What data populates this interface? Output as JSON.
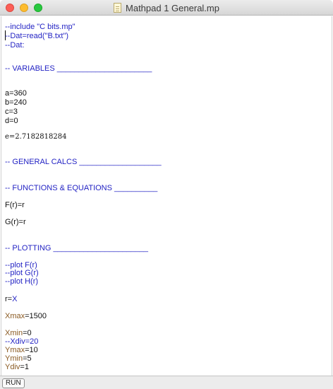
{
  "window": {
    "title": "Mathpad 1 General.mp"
  },
  "editor": {
    "lines": [
      {
        "text": "--include \"C bits.mp\""
      },
      {
        "text": "--Dat=read(\"B.txt\")"
      },
      {
        "text": "--Dat:"
      },
      {
        "text": "-- VARIABLES ______________________"
      },
      {
        "text": "a=360"
      },
      {
        "text": "b=240"
      },
      {
        "text": "c=3"
      },
      {
        "text": "d=0"
      },
      {
        "text": "e=2.7182818284"
      },
      {
        "text": "-- GENERAL CALCS ___________________"
      },
      {
        "text": "-- FUNCTIONS & EQUATIONS __________"
      },
      {
        "text": "F(r)=r"
      },
      {
        "text": "G(r)=r"
      },
      {
        "text": "-- PLOTTING ______________________"
      },
      {
        "text": "--plot F(r)"
      },
      {
        "text": "--plot G(r)"
      },
      {
        "text": "--plot H(r)"
      },
      {
        "text": "r=X"
      },
      {
        "text": "Xmax=1500"
      },
      {
        "text": "Xmin=0"
      },
      {
        "text": "--Xdiv=20"
      },
      {
        "text": "Ymax=10"
      },
      {
        "text": "Ymin=5"
      },
      {
        "text": "Ydiv=1"
      }
    ]
  },
  "toolbar": {
    "run_label": "RUN"
  },
  "colors": {
    "comment": "#2323c4",
    "text": "#111111",
    "variable": "#8a5a22"
  }
}
